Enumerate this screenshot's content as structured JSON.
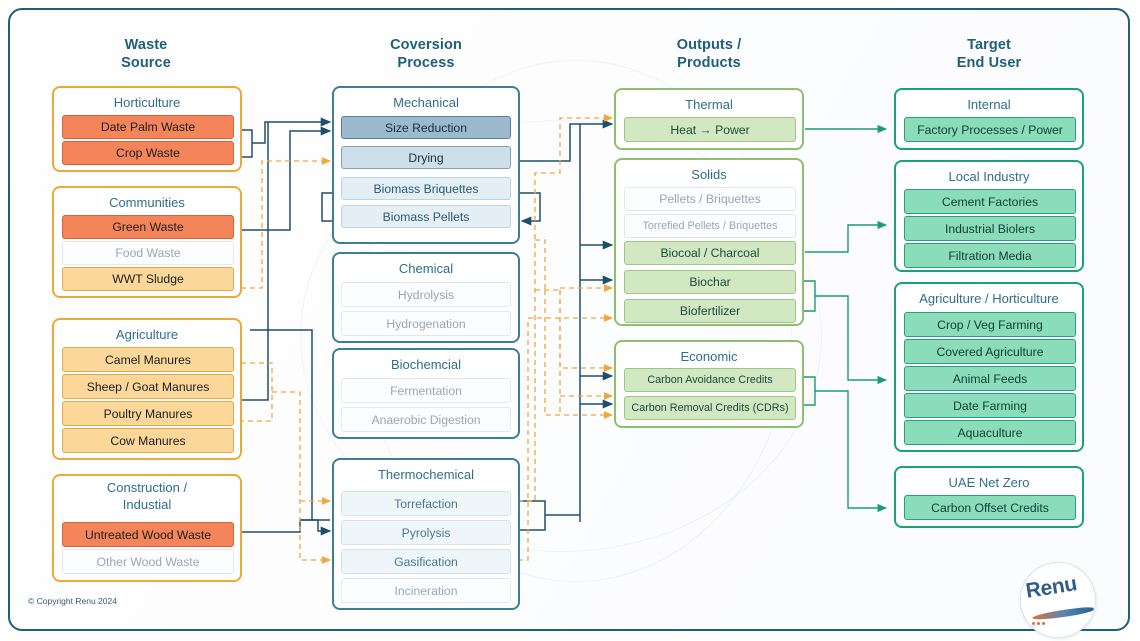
{
  "diagram": {
    "copyright": "© Copyright Renu 2024",
    "logo_text": "Renu",
    "colors": {
      "frame": "#1f5f79",
      "heading": "#1f5f79",
      "orange_group": "#eda83a",
      "blue_group": "#3d7e96",
      "light_green_group": "#8cc06a",
      "teal_green_group": "#19a179",
      "chip_orange_dark": "#f4855a",
      "chip_orange_light": "#fbd79a",
      "chip_blue_dark": "#9db9cc",
      "chip_green_light": "#d2e8c3",
      "chip_green_teal": "#8adcbb",
      "wire_blue": "#1f4e6b",
      "wire_orange_dashed": "#f0a73c",
      "wire_green": "#1a9c74"
    }
  },
  "columns": {
    "waste_source": {
      "title_line1": "Waste",
      "title_line2": "Source"
    },
    "conversion": {
      "title_line1": "Coversion",
      "title_line2": "Process"
    },
    "outputs": {
      "title_line1": "Outputs /",
      "title_line2": "Products"
    },
    "target": {
      "title_line1": "Target",
      "title_line2": "End User"
    }
  },
  "waste_source_groups": [
    {
      "title": "Horticulture",
      "items": [
        {
          "label": "Date Palm Waste",
          "state": "active"
        },
        {
          "label": "Crop Waste",
          "state": "active"
        }
      ]
    },
    {
      "title": "Communities",
      "items": [
        {
          "label": "Green Waste",
          "state": "active"
        },
        {
          "label": "Food Waste",
          "state": "muted"
        },
        {
          "label": "WWT Sludge",
          "state": "secondary"
        }
      ]
    },
    {
      "title": "Agriculture",
      "items": [
        {
          "label": "Camel Manures",
          "state": "secondary"
        },
        {
          "label": "Sheep / Goat Manures",
          "state": "secondary"
        },
        {
          "label": "Poultry Manures",
          "state": "secondary"
        },
        {
          "label": "Cow Manures",
          "state": "secondary"
        }
      ]
    },
    {
      "title_line1": "Construction /",
      "title_line2": "Industial",
      "title": "Construction / Industial",
      "items": [
        {
          "label": "Untreated Wood Waste",
          "state": "active"
        },
        {
          "label": "Other Wood Waste",
          "state": "muted"
        }
      ]
    }
  ],
  "conversion_groups": [
    {
      "title": "Mechanical",
      "items": [
        {
          "label": "Size Reduction",
          "state": "primary"
        },
        {
          "label": "Drying",
          "state": "secondary"
        },
        {
          "label": "Biomass Briquettes",
          "state": "tertiary"
        },
        {
          "label": "Biomass Pellets",
          "state": "tertiary"
        }
      ]
    },
    {
      "title": "Chemical",
      "items": [
        {
          "label": "Hydrolysis",
          "state": "muted"
        },
        {
          "label": "Hydrogenation",
          "state": "muted"
        }
      ]
    },
    {
      "title": "Biochemcial",
      "items": [
        {
          "label": "Fermentation",
          "state": "muted"
        },
        {
          "label": "Anaerobic Digestion",
          "state": "muted"
        }
      ]
    },
    {
      "title": "Thermochemical",
      "items": [
        {
          "label": "Torrefaction",
          "state": "tertiary"
        },
        {
          "label": "Pyrolysis",
          "state": "tertiary"
        },
        {
          "label": "Gasification",
          "state": "tertiary"
        },
        {
          "label": "Incineration",
          "state": "muted"
        }
      ]
    }
  ],
  "output_groups": [
    {
      "title": "Thermal",
      "items": [
        {
          "label": "Heat → Power",
          "state": "active"
        }
      ]
    },
    {
      "title": "Solids",
      "items": [
        {
          "label": "Pellets / Briquettes",
          "state": "muted"
        },
        {
          "label": "Torrefied Pellets / Briquettes",
          "state": "muted"
        },
        {
          "label": "Biocoal / Charcoal",
          "state": "active"
        },
        {
          "label": "Biochar",
          "state": "active"
        },
        {
          "label": "Biofertilizer",
          "state": "active"
        }
      ]
    },
    {
      "title": "Economic",
      "items": [
        {
          "label": "Carbon Avoidance Credits",
          "state": "active"
        },
        {
          "label": "Carbon Removal Credits (CDRs)",
          "state": "active"
        }
      ]
    }
  ],
  "target_groups": [
    {
      "title": "Internal",
      "items": [
        {
          "label": "Factory Processes / Power",
          "state": "active"
        }
      ]
    },
    {
      "title": "Local Industry",
      "items": [
        {
          "label": "Cement Factories",
          "state": "active"
        },
        {
          "label": "Industrial Biolers",
          "state": "active"
        },
        {
          "label": "Filtration Media",
          "state": "active"
        }
      ]
    },
    {
      "title": "Agriculture / Horticulture",
      "items": [
        {
          "label": "Crop / Veg Farming",
          "state": "active"
        },
        {
          "label": "Covered Agriculture",
          "state": "active"
        },
        {
          "label": "Animal Feeds",
          "state": "active"
        },
        {
          "label": "Date Farming",
          "state": "active"
        },
        {
          "label": "Aquaculture",
          "state": "active"
        }
      ]
    },
    {
      "title": "UAE Net Zero",
      "items": [
        {
          "label": "Carbon Offset Credits",
          "state": "active"
        }
      ]
    }
  ]
}
